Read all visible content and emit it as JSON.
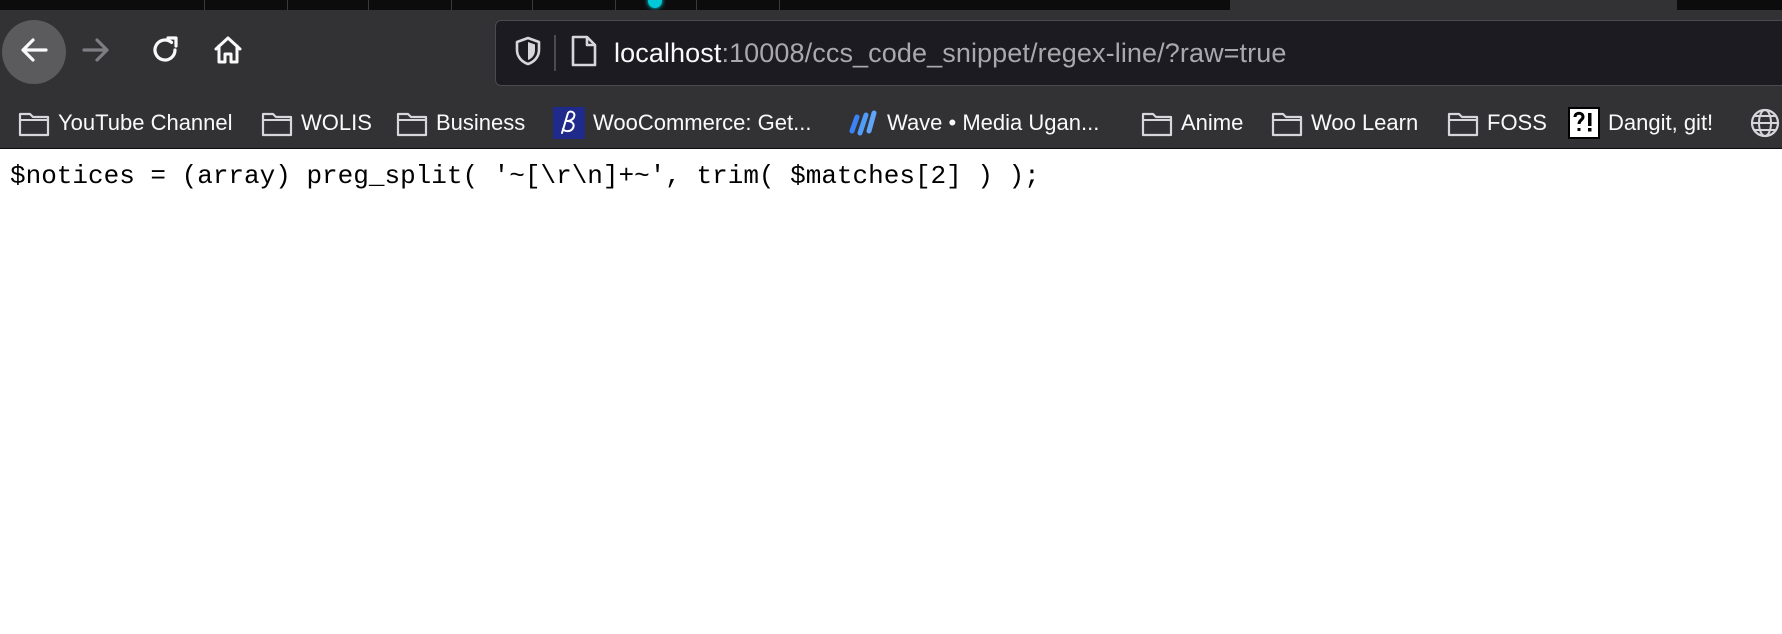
{
  "toolbar": {
    "icons": {
      "back": "back-arrow-icon",
      "forward": "forward-arrow-icon",
      "reload": "reload-icon",
      "home": "home-icon"
    }
  },
  "urlbar": {
    "host": "localhost",
    "rest": ":10008/ccs_code_snippet/regex-line/?raw=true",
    "icons": {
      "shield": "tracking-protection-shield-icon",
      "page": "page-icon"
    }
  },
  "bookmarks": [
    {
      "label": "YouTube Channel",
      "icon": "folder-icon"
    },
    {
      "label": "WOLIS",
      "icon": "folder-icon"
    },
    {
      "label": "Business",
      "icon": "folder-icon"
    },
    {
      "label": "WooCommerce: Get...",
      "icon": "woocommerce-logo-icon"
    },
    {
      "label": "Wave • Media Ugan...",
      "icon": "wave-logo-icon"
    },
    {
      "label": "Anime",
      "icon": "folder-icon"
    },
    {
      "label": "Woo Learn",
      "icon": "folder-icon"
    },
    {
      "label": "FOSS",
      "icon": "folder-icon"
    },
    {
      "label": "Dangit, git!",
      "icon": "dangit-git-logo-icon"
    },
    {
      "label": "",
      "icon": "globe-icon"
    }
  ],
  "page": {
    "code": "$notices = (array) preg_split( '~[\\r\\n]+~', trim( $matches[2] ) );"
  },
  "colors": {
    "chrome": "#323234",
    "tabstrip": "#0c0c0d",
    "urlbar": "#1c1b22",
    "text_light": "#f9f9fa",
    "text_muted": "#a8a8ad",
    "audio_dot": "#00c8d7"
  }
}
